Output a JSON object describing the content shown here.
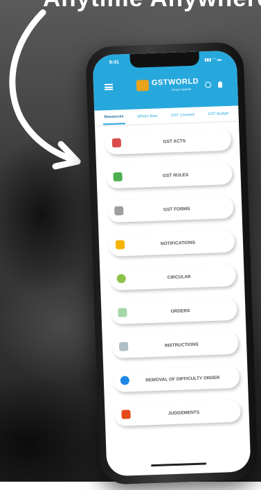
{
  "headline": "Anytime Anywhere",
  "app": {
    "status_time": "9:41",
    "status_icons": "▮▮▮ ◠ ▬",
    "logo_text": "GSTWORLD",
    "logo_sub": "Always Updated",
    "tabs": [
      {
        "label": "Resources",
        "active": true
      },
      {
        "label": "What's New",
        "active": false
      },
      {
        "label": "GST Covered",
        "active": false
      },
      {
        "label": "GST Budget",
        "active": false
      }
    ],
    "items": [
      {
        "label": "GST ACTS",
        "icon": "acts-icon",
        "color": "#d94a4a"
      },
      {
        "label": "GST RULES",
        "icon": "rules-icon",
        "color": "#4caf50"
      },
      {
        "label": "GST FORMS",
        "icon": "forms-icon",
        "color": "#9e9e9e"
      },
      {
        "label": "NOTIFICATIONS",
        "icon": "notifications-icon",
        "color": "#f4b400"
      },
      {
        "label": "CIRCULAR",
        "icon": "circular-icon",
        "color": "#8bc34a"
      },
      {
        "label": "ORDERS",
        "icon": "orders-icon",
        "color": "#a5d6a7"
      },
      {
        "label": "INSTRUCTIONS",
        "icon": "instructions-icon",
        "color": "#b0bec5"
      },
      {
        "label": "REMOVAL OF DIFFICULTY ORDER",
        "icon": "removal-order-icon",
        "color": "#1e88e5"
      },
      {
        "label": "JUDGEMENTS",
        "icon": "judgements-icon",
        "color": "#e64a19"
      }
    ]
  },
  "colors": {
    "header_blue": "#27a8dd",
    "logo_orange": "#e8a21c"
  }
}
